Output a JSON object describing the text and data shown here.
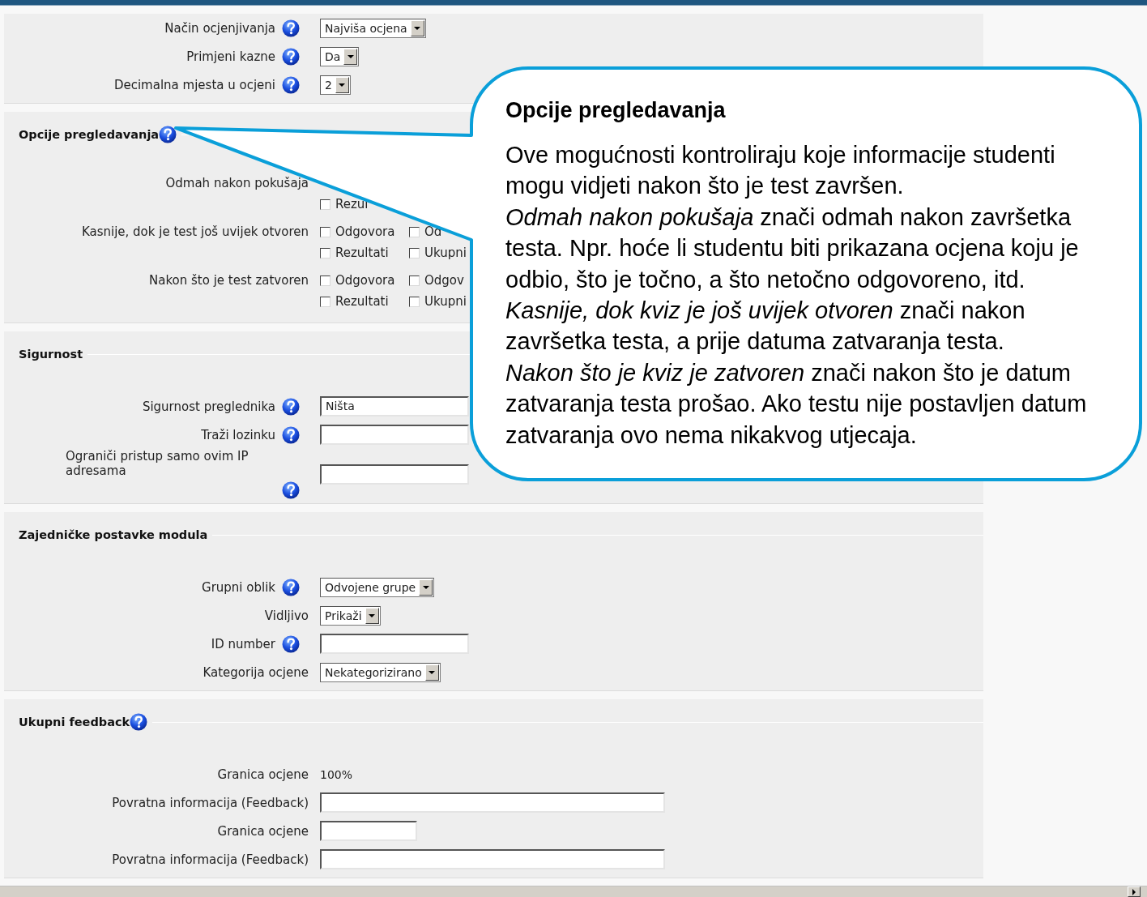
{
  "sections": [
    {
      "rows": [
        {
          "label": "Način ocjenjivanja",
          "help": true,
          "kind": "select",
          "value": "Najviša ocjena"
        },
        {
          "label": "Primjeni kazne",
          "help": true,
          "kind": "select",
          "value": "Da"
        },
        {
          "label": "Decimalna mjesta u ocjeni",
          "help": true,
          "kind": "select",
          "value": "2"
        }
      ]
    },
    {
      "title": "Opcije pregledavanja",
      "help": true,
      "rows": [
        {
          "label": "Odmah nakon pokušaja",
          "help": false,
          "kind": "checks",
          "lines": [
            {
              "items": [
                {
                  "label": "Rezul",
                  "checked": false
                }
              ]
            }
          ]
        },
        {
          "label": "Kasnije, dok je test još uvijek otvoren",
          "help": false,
          "kind": "checks",
          "lines": [
            {
              "items": [
                {
                  "label": "Odgovora",
                  "checked": false
                },
                {
                  "label": "Od",
                  "checked": false
                }
              ]
            },
            {
              "items": [
                {
                  "label": "Rezultati",
                  "checked": false
                },
                {
                  "label": "Ukupni",
                  "checked": false
                }
              ]
            }
          ]
        },
        {
          "label": "Nakon što je test zatvoren",
          "help": false,
          "kind": "checks",
          "lines": [
            {
              "items": [
                {
                  "label": "Odgovora",
                  "checked": false
                },
                {
                  "label": "Odgov",
                  "checked": false
                }
              ]
            },
            {
              "items": [
                {
                  "label": "Rezultati",
                  "checked": false
                },
                {
                  "label": "Ukupni",
                  "checked": false
                }
              ]
            }
          ]
        }
      ]
    },
    {
      "title": "Sigurnost",
      "help": false,
      "rows": [
        {
          "label": "Sigurnost preglednika",
          "help": true,
          "kind": "input",
          "value": "Ništa"
        },
        {
          "label": "Traži lozinku",
          "help": true,
          "kind": "input"
        },
        {
          "label": "Ograniči pristup samo ovim IP adresama",
          "help": true,
          "kind": "input"
        }
      ]
    },
    {
      "title": "Zajedničke postavke modula",
      "help": false,
      "rows": [
        {
          "label": "Grupni oblik",
          "help": true,
          "kind": "select",
          "value": "Odvojene grupe"
        },
        {
          "label": "Vidljivo",
          "help": false,
          "kind": "select",
          "value": "Prikaži"
        },
        {
          "label": "ID number",
          "help": true,
          "kind": "input"
        },
        {
          "label": "Kategorija ocjene",
          "help": false,
          "kind": "select",
          "value": "Nekategorizirano"
        }
      ]
    },
    {
      "title": "Ukupni feedback",
      "help": true,
      "rows": [
        {
          "label": "Granica ocjene",
          "help": false,
          "kind": "text",
          "value": "100%"
        },
        {
          "label": "Povratna informacija (Feedback)",
          "help": false,
          "kind": "long_input"
        },
        {
          "label": "Granica ocjene",
          "help": false,
          "kind": "short_input"
        },
        {
          "label": "Povratna informacija (Feedback)",
          "help": false,
          "kind": "long_input"
        }
      ]
    }
  ],
  "callout": {
    "title": "Opcije pregledavanja",
    "paragraphs": [
      "Ove mogućnosti kontroliraju koje informacije studenti mogu vidjeti nakon što je test završen.",
      "*Odmah nakon pokušaja* znači odmah nakon završetka testa. Npr. hoće li studentu biti prikazana ocjena koju je odbio, što je točno, a što netočno odgovoreno, itd.",
      "*Kasnije, dok kviz je još uvijek otvoren* znači nakon završetka testa, a prije datuma zatvaranja testa.",
      "*Nakon što je kviz je zatvoren* znači nakon što je datum zatvaranja testa prošao. Ako testu nije postavljen datum zatvaranja ovo nema nikakvog utjecaja."
    ]
  }
}
